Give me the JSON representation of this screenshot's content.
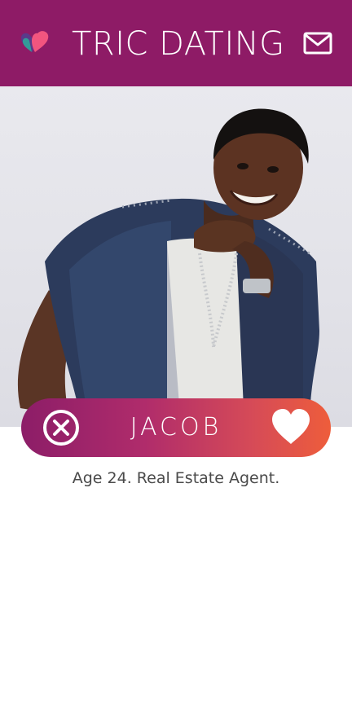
{
  "header": {
    "title": "TRIC DATING",
    "logo_icon": "hearts-logo-icon",
    "mail_icon": "mail-icon",
    "background_color": "#8e1b66"
  },
  "profile": {
    "name": "JACOB",
    "bio": "Age 24. Real Estate Agent.",
    "photo": "profile-photo",
    "reject_icon": "close-circle-icon",
    "like_icon": "heart-icon",
    "gradient_start": "#8c1d68",
    "gradient_end": "#ee5d3b"
  }
}
